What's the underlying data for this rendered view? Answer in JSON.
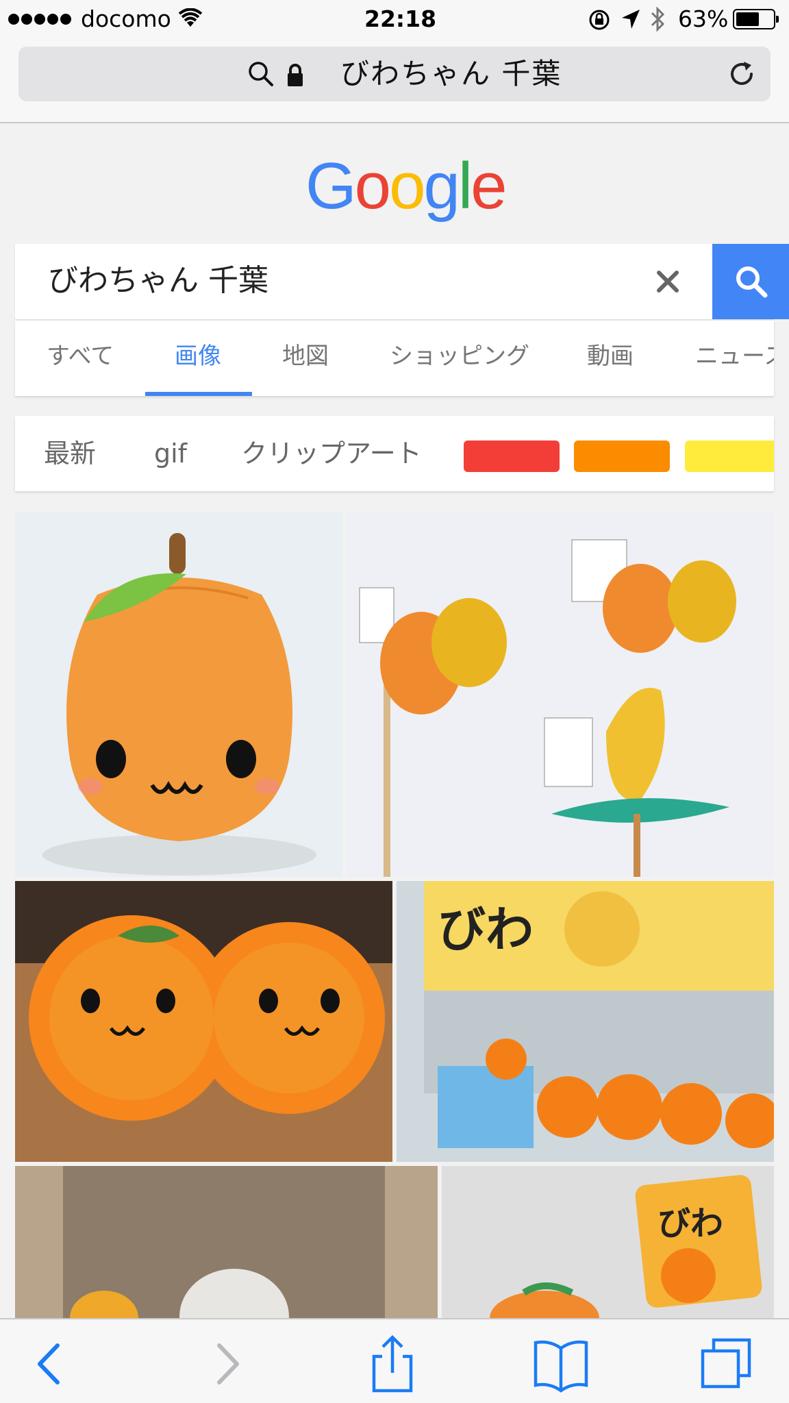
{
  "status_bar": {
    "carrier": "docomo",
    "time": "22:18",
    "battery_percent": "63%",
    "battery_level": 0.63
  },
  "address_bar": {
    "url_text": "びわちゃん 千葉"
  },
  "logo": {
    "letters": [
      "G",
      "o",
      "o",
      "g",
      "l",
      "e"
    ],
    "colors": [
      "#4285f4",
      "#ea4335",
      "#fbbc05",
      "#4285f4",
      "#34a853",
      "#ea4335"
    ]
  },
  "search": {
    "query": "びわちゃん 千葉",
    "button_color": "#4285f4"
  },
  "tabs": [
    {
      "label": "すべて",
      "active": false
    },
    {
      "label": "画像",
      "active": true
    },
    {
      "label": "地図",
      "active": false
    },
    {
      "label": "ショッピング",
      "active": false
    },
    {
      "label": "動画",
      "active": false
    },
    {
      "label": "ニュース",
      "active": false
    }
  ],
  "filters": {
    "chips": [
      "最新",
      "gif",
      "クリップアート"
    ],
    "color_swatches": [
      "#f33e37",
      "#fb8c00",
      "#ffeb3b"
    ]
  },
  "images": [
    {
      "subject": "orange-plush-mascot"
    },
    {
      "subject": "mascot-keychains"
    },
    {
      "subject": "orange-mop-slippers"
    },
    {
      "subject": "biwa-chan-shop-display"
    },
    {
      "subject": "plush-in-hallway"
    },
    {
      "subject": "biwa-chan-strap-package"
    }
  ],
  "toolbar": {
    "icons": [
      "back-icon",
      "forward-icon",
      "share-icon",
      "bookmarks-icon",
      "tabs-icon"
    ]
  }
}
